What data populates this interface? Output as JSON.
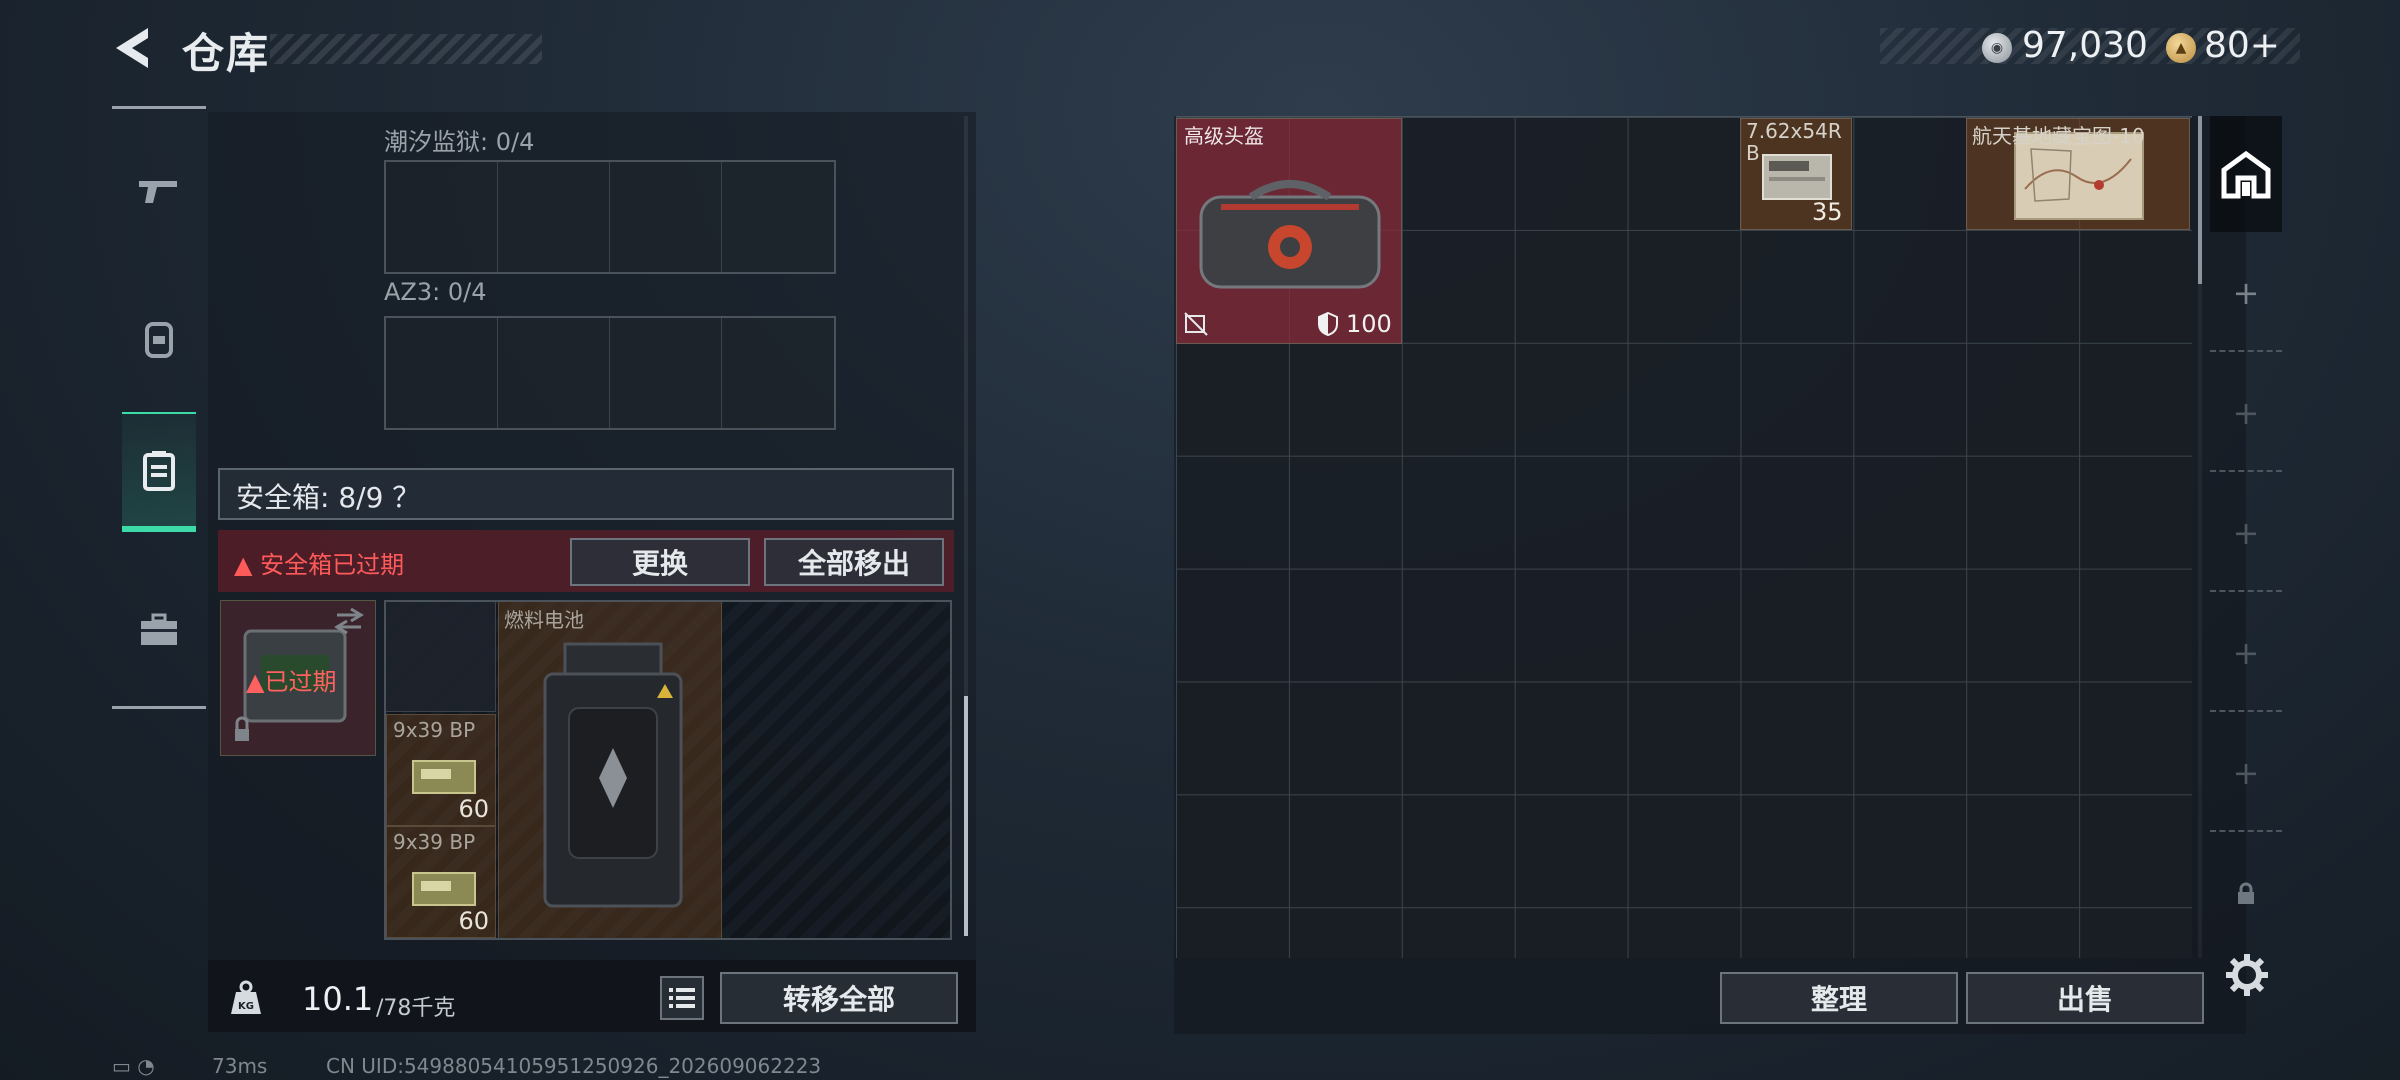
{
  "header": {
    "title": "仓库",
    "silver": "97,030",
    "gold": "80+"
  },
  "left": {
    "sections": [
      {
        "label": "潮汐监狱: 0/4"
      },
      {
        "label": "AZ3: 0/4"
      }
    ],
    "safebox": {
      "label": "安全箱: 8/9 ？",
      "warning": "安全箱已过期",
      "replace_label": "更换",
      "move_all_label": "全部移出",
      "expired_label": "已过期",
      "fuel_label": "燃料电池",
      "ammo": [
        {
          "label": "9x39 BP",
          "count": "60"
        },
        {
          "label": "9x39 BP",
          "count": "60"
        }
      ]
    },
    "footer": {
      "weight": "10.1",
      "weight_max": "/78千克",
      "transfer_label": "转移全部"
    }
  },
  "right": {
    "items": {
      "helmet_name": "高级头盔",
      "helmet_durability": "100",
      "ammo_name": "7.62x54R B",
      "ammo_count": "35",
      "map_name": "航天基地藏宝图-10"
    },
    "sort_label": "整理",
    "sell_label": "出售"
  },
  "status": {
    "ping": "73ms",
    "uid": "CN UID:549880541059512509​26_202609062223"
  },
  "colors": {
    "accent": "#3ddba7",
    "warning": "#ff5a5a",
    "helmet_bg": "#872c3a"
  }
}
